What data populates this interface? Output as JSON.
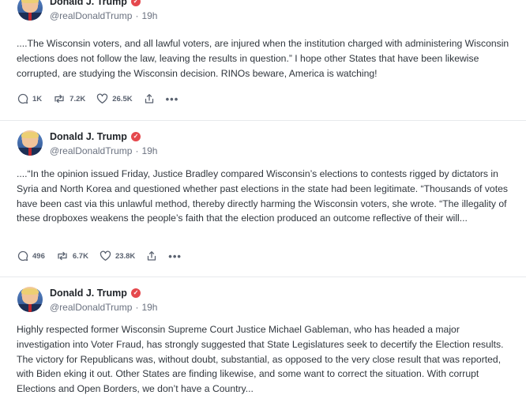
{
  "posts": [
    {
      "author": "Donald J. Trump",
      "handle": "@realDonaldTrump",
      "time": "19h",
      "text": "....The Wisconsin voters, and all lawful voters, are injured when the institution charged with administering Wisconsin elections does not follow the law, leaving the results in question.” I hope other States that have been likewise corrupted, are studying the Wisconsin decision. RINOs beware, America is watching!",
      "replies": "1K",
      "reposts": "7.2K",
      "likes": "26.5K"
    },
    {
      "author": "Donald J. Trump",
      "handle": "@realDonaldTrump",
      "time": "19h",
      "text": "....“In the opinion issued Friday, Justice Bradley compared Wisconsin’s elections to contests rigged by dictators in Syria and North Korea and questioned whether past elections in the state had been legitimate. “Thousands of votes have been cast via this unlawful method, thereby directly harming the Wisconsin voters, she wrote. “The illegality of these dropboxes weakens the people’s faith that the election produced an outcome reflective of their will...",
      "replies": "496",
      "reposts": "6.7K",
      "likes": "23.8K"
    },
    {
      "author": "Donald J. Trump",
      "handle": "@realDonaldTrump",
      "time": "19h",
      "text": "Highly respected former Wisconsin Supreme Court Justice Michael Gableman, who has headed a major investigation into Voter Fraud, has strongly suggested that State Legislatures seek to decertify the Election results. The victory for Republicans was, without doubt, substantial, as opposed to the very close result that was reported, with Biden eking it out. Other States are finding likewise, and some want to correct the situation. With corrupt Elections and Open Borders, we don’t have a Country..."
    }
  ],
  "separator": "·",
  "icons": {
    "verified": "verified-badge-icon",
    "reply": "reply-bubble-icon",
    "repost": "repost-arrows-icon",
    "like": "heart-icon",
    "share": "share-upload-icon",
    "more": "more-dots-icon"
  },
  "colors": {
    "verified_badge": "#e5484d"
  }
}
